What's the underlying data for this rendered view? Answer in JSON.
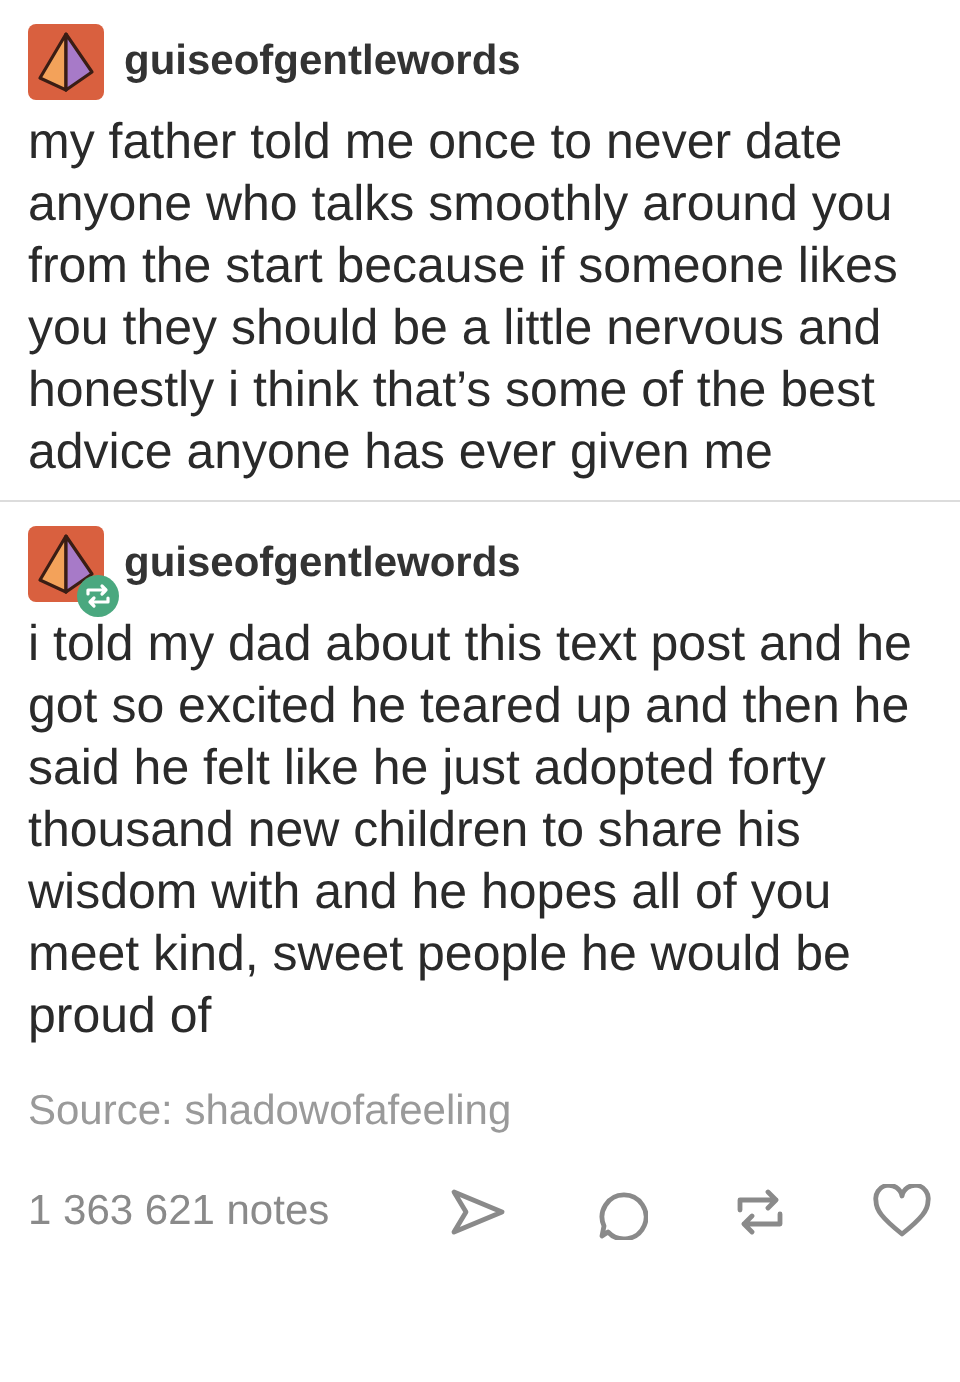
{
  "posts": [
    {
      "username": "guiseofgentlewords",
      "reblogged": false,
      "text": "my father told me once to never date anyone who talks smoothly around you from the start because if someone likes you they should be a little nervous and honestly i think that’s some of the best advice anyone has ever given me"
    },
    {
      "username": "guiseofgentlewords",
      "reblogged": true,
      "text": "i told my dad about this text post and he got so excited he teared up and then he said he felt like he just adopted forty thousand new children to share his wisdom with and he hopes all of you meet kind, sweet people he would be proud of"
    }
  ],
  "source": "Source: shadowofafeeling",
  "notes": "1 363 621 notes"
}
